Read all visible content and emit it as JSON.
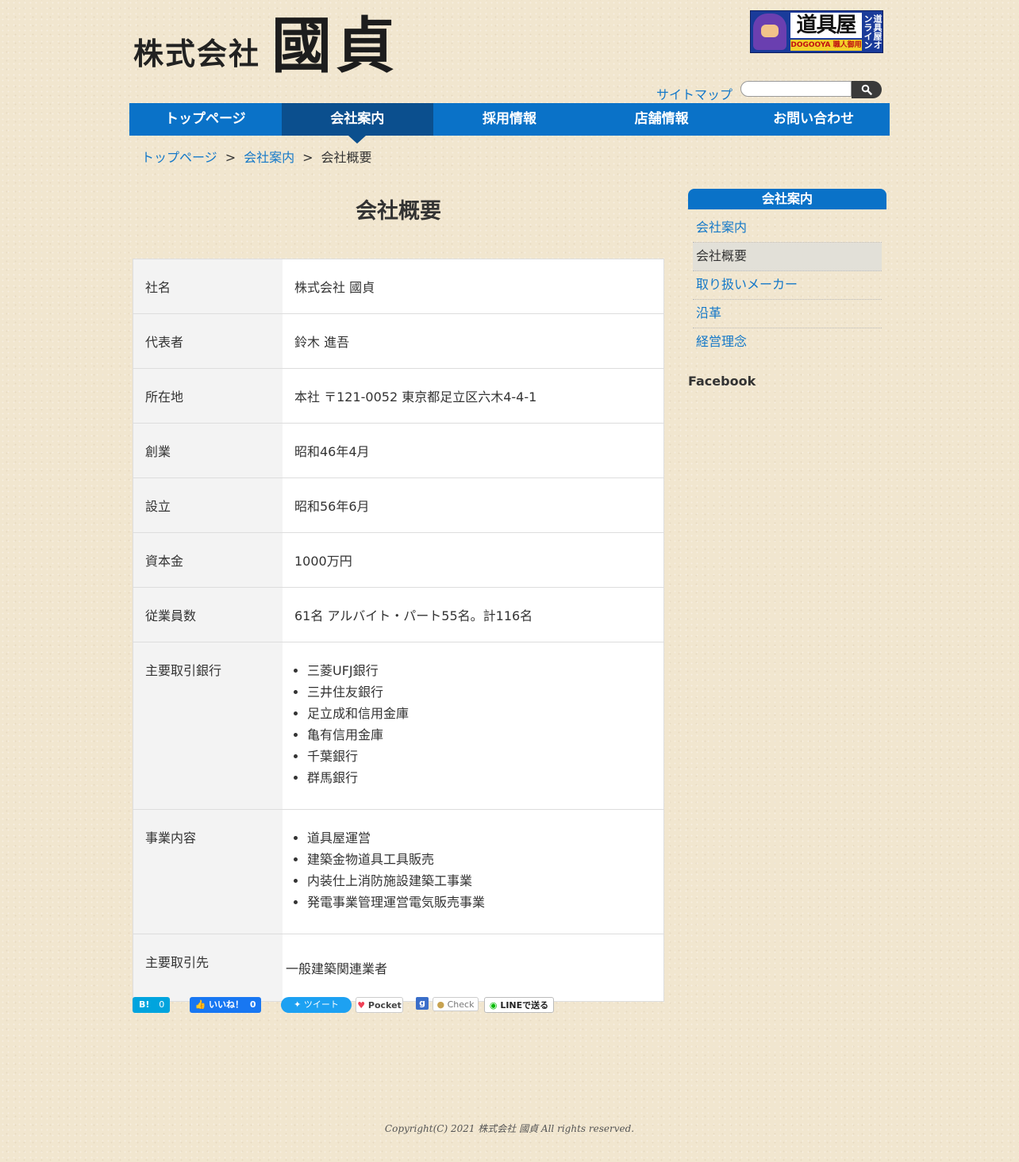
{
  "header": {
    "logo_small": "株式会社",
    "logo_big": "國貞",
    "banner": {
      "main": "道具屋",
      "sub": "DOGOOYA 職人御用達",
      "side": "道具屋オンライン"
    },
    "sitemap_label": "サイトマップ",
    "search_placeholder": "",
    "search_icon": "magnifier-icon"
  },
  "nav": {
    "items": [
      {
        "label": "トップページ"
      },
      {
        "label": "会社案内",
        "active": true
      },
      {
        "label": "採用情報"
      },
      {
        "label": "店舗情報"
      },
      {
        "label": "お問い合わせ"
      }
    ]
  },
  "breadcrumb": {
    "items": [
      "トップページ",
      "会社案内",
      "会社概要"
    ],
    "separator": ">"
  },
  "main": {
    "title": "会社概要",
    "rows": [
      {
        "label": "社名",
        "value": "株式会社 國貞"
      },
      {
        "label": "代表者",
        "value": "鈴木 進吾"
      },
      {
        "label": "所在地",
        "value": "本社 〒121-0052 東京都足立区六木4-4-1"
      },
      {
        "label": "創業",
        "value": "昭和46年4月"
      },
      {
        "label": "設立",
        "value": "昭和56年6月"
      },
      {
        "label": "資本金",
        "value": "1000万円"
      },
      {
        "label": "従業員数",
        "value": "61名 アルバイト・パート55名。計116名"
      }
    ],
    "banks": {
      "label": "主要取引銀行",
      "items": [
        "三菱UFJ銀行",
        "三井住友銀行",
        "足立成和信用金庫",
        "亀有信用金庫",
        "千葉銀行",
        "群馬銀行"
      ]
    },
    "business": {
      "label": "事業内容",
      "items": [
        "道具屋運営",
        "建築金物道具工具販売",
        "内装仕上消防施設建築工事業",
        "発電事業管理運営電気販売事業"
      ]
    },
    "clients": {
      "label": "主要取引先",
      "value": "一般建築関連業者"
    }
  },
  "share": {
    "hatena": {
      "label": "B!",
      "count": "0"
    },
    "like": {
      "label": "いいね！",
      "count": "0"
    },
    "tweet": {
      "label": "ツイート"
    },
    "pocket": {
      "label": "Pocket"
    },
    "google": {
      "label": "g"
    },
    "check": {
      "label": "Check"
    },
    "line": {
      "label": "LINEで送る"
    }
  },
  "sidebar": {
    "heading": "会社案内",
    "items": [
      {
        "label": "会社案内"
      },
      {
        "label": "会社概要",
        "current": true
      },
      {
        "label": "取り扱いメーカー"
      },
      {
        "label": "沿革"
      },
      {
        "label": "経営理念"
      }
    ],
    "facebook_label": "Facebook"
  },
  "footer": {
    "copyright": "Copyright(C) 2021 株式会社 國貞 All rights reserved."
  },
  "colors": {
    "nav_bg": "#0a72c8",
    "nav_active": "#0b4f8e",
    "link": "#1478c8",
    "page_bg": "#f1e6cf"
  }
}
